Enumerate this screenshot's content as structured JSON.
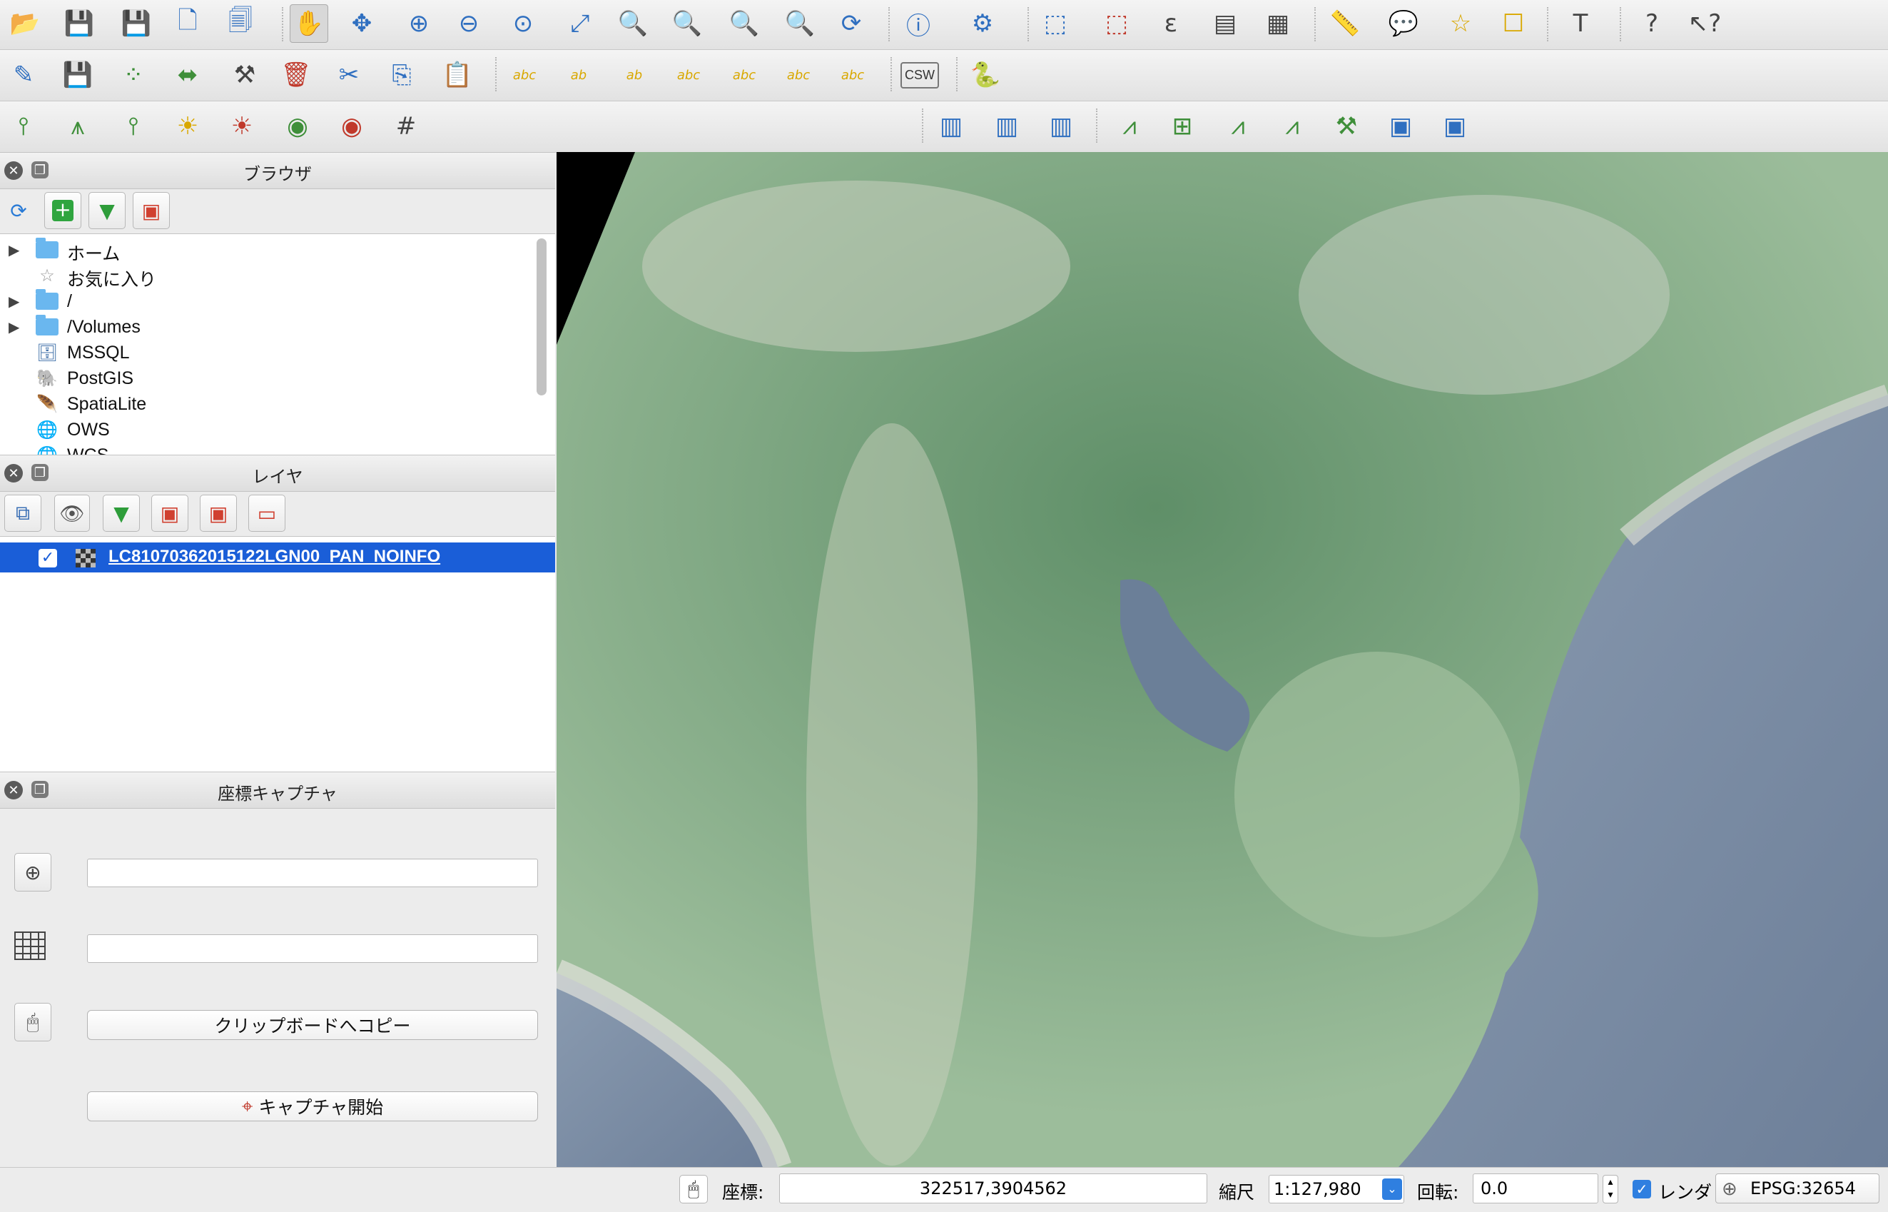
{
  "toolbars": {
    "row1_icons": [
      "open-project-icon",
      "save-project-icon",
      "save-as-icon",
      "new-print-composer-icon",
      "composer-manager-icon",
      "pan-icon",
      "pan-to-selection-icon",
      "zoom-in-icon",
      "zoom-out-icon",
      "zoom-native-icon",
      "zoom-full-icon",
      "zoom-to-selection-icon",
      "zoom-to-layer-icon",
      "zoom-last-icon",
      "zoom-next-icon",
      "refresh-icon",
      "identify-icon",
      "run-feature-action-icon",
      "select-features-icon",
      "deselect-icon",
      "select-by-expression-icon",
      "open-attribute-table-icon",
      "field-calculator-icon",
      "measure-icon",
      "map-tips-icon",
      "new-bookmark-icon",
      "show-bookmarks-icon",
      "text-annotation-icon",
      "help-icon",
      "whats-this-icon"
    ],
    "row2_icons": [
      "toggle-editing-icon",
      "save-edits-icon",
      "add-feature-icon",
      "move-feature-icon",
      "node-tool-icon",
      "delete-selected-icon",
      "cut-features-icon",
      "copy-features-icon",
      "paste-features-icon",
      "label-icon",
      "pin-labels-icon",
      "highlight-pinned-icon",
      "show-hide-labels-icon",
      "move-label-icon",
      "rotate-label-icon",
      "change-label-icon",
      "metasearch-icon",
      "python-console-icon"
    ],
    "row2_csw": "CSW",
    "row3_icons": [
      "advanced-digitize-1-icon",
      "advanced-digitize-2-icon",
      "advanced-digitize-3-icon",
      "sun-add-icon",
      "sun-remove-icon",
      "gps-add-icon",
      "gps-remove-icon",
      "grid-icon",
      "raster-1-icon",
      "raster-2-icon",
      "raster-3-icon",
      "vector-new-icon",
      "vector-add-icon",
      "vector-3-icon",
      "vector-4-icon",
      "vector-5-icon",
      "vector-6-icon",
      "vector-7-icon"
    ]
  },
  "browser_panel": {
    "title": "ブラウザ",
    "items": [
      {
        "label": "ホーム",
        "icon": "folder",
        "expandable": true
      },
      {
        "label": "お気に入り",
        "icon": "star",
        "expandable": false
      },
      {
        "label": "/",
        "icon": "folder",
        "expandable": true
      },
      {
        "label": "/Volumes",
        "icon": "folder",
        "expandable": true
      },
      {
        "label": "MSSQL",
        "icon": "mssql",
        "expandable": false
      },
      {
        "label": "PostGIS",
        "icon": "postgis",
        "expandable": false
      },
      {
        "label": "SpatiaLite",
        "icon": "spatialite",
        "expandable": false
      },
      {
        "label": "OWS",
        "icon": "globe",
        "expandable": false
      },
      {
        "label": "WCS",
        "icon": "globe",
        "expandable": false
      }
    ]
  },
  "layers_panel": {
    "title": "レイヤ",
    "layers": [
      {
        "name": "LC81070362015122LGN00_PAN_NOINFO",
        "checked": true,
        "selected": true
      }
    ]
  },
  "coord_capture_panel": {
    "title": "座標キャプチャ",
    "copy_button": "クリップボードへコピー",
    "start_button": "キャプチャ開始"
  },
  "statusbar": {
    "coord_label": "座標:",
    "coord_value": "322517,3904562",
    "scale_label": "縮尺",
    "scale_value": "1:127,980",
    "rotation_label": "回転:",
    "rotation_value": "0.0",
    "render_label": "レンダ",
    "render_checked": true,
    "crs": "EPSG:32654"
  },
  "colors": {
    "selection": "#1a5ed8",
    "map_land": "#8fb594",
    "map_sea": "#7f90a8",
    "toolbar_bg": "#e8e8e8"
  }
}
